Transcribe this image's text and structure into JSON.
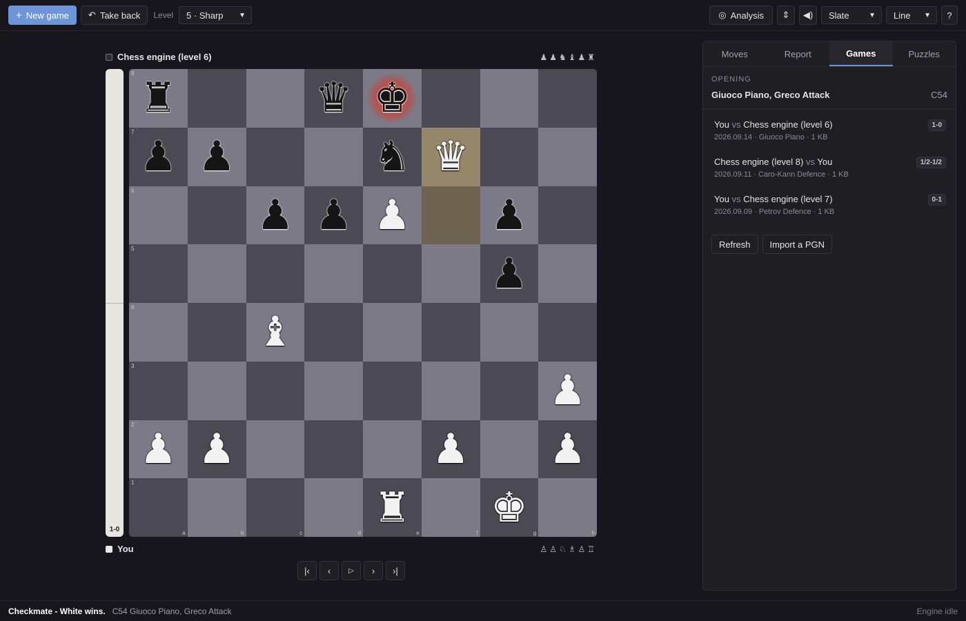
{
  "toolbar": {
    "new_game": "New game",
    "take_back": "Take back",
    "level_label": "Level",
    "level_value": "5 · Sharp",
    "analysis": "Analysis",
    "theme_value": "Slate",
    "style_value": "Line"
  },
  "top_player": {
    "name": "Chess engine (level 6)",
    "captured": "♟♟♞♝♟♜"
  },
  "bottom_player": {
    "name": "You",
    "captured": "♙♙♘♗♙♖"
  },
  "eval": {
    "score": "1-0",
    "white_fraction": 1.0
  },
  "board": {
    "ranks": [
      "8",
      "7",
      "6",
      "5",
      "4",
      "3",
      "2",
      "1"
    ],
    "files": [
      "a",
      "b",
      "c",
      "d",
      "e",
      "f",
      "g",
      "h"
    ],
    "rows": [
      [
        "r",
        "",
        "",
        "q",
        "k",
        "",
        "",
        ""
      ],
      [
        "p",
        "p",
        "",
        "",
        "n",
        "Q",
        "",
        ""
      ],
      [
        "",
        "",
        "p",
        "p",
        "P",
        "",
        "p",
        ""
      ],
      [
        "",
        "",
        "",
        "",
        "",
        "",
        "p",
        ""
      ],
      [
        "",
        "",
        "B",
        "",
        "",
        "",
        "",
        ""
      ],
      [
        "",
        "",
        "",
        "",
        "",
        "",
        "",
        "P"
      ],
      [
        "P",
        "P",
        "",
        "",
        "",
        "P",
        "",
        "P"
      ],
      [
        "",
        "",
        "",
        "",
        "R",
        "",
        "K",
        ""
      ]
    ],
    "last_move": [
      "f7",
      "f6"
    ],
    "check_square": "e8"
  },
  "panel": {
    "tabs": [
      "Moves",
      "Report",
      "Games",
      "Puzzles"
    ],
    "active_tab": "Games",
    "opening_label": "OPENING",
    "opening_name": "Giuoco Piano, Greco Attack",
    "opening_eco": "C54",
    "games": [
      {
        "white": "You",
        "vs": "vs",
        "black": "Chess engine (level 6)",
        "meta": "2026.09.14 · Giuoco Piano · 1 KB",
        "result": "1-0"
      },
      {
        "white": "Chess engine (level 8)",
        "vs": "vs",
        "black": "You",
        "meta": "2026.09.11 · Caro-Kann Defence · 1 KB",
        "result": "1/2-1/2"
      },
      {
        "white": "You",
        "vs": "vs",
        "black": "Chess engine (level 7)",
        "meta": "2026.09.09 · Petrov Defence · 1 KB",
        "result": "0-1"
      }
    ],
    "refresh": "Refresh",
    "import_pgn": "Import a PGN"
  },
  "status": {
    "main": "Checkmate - White wins.",
    "sub": "C54 Giuoco Piano, Greco Attack",
    "engine": "Engine idle"
  },
  "colors": {
    "accent": "#6d96d9",
    "light_square": "#7b7a86",
    "dark_square": "#4b4a54",
    "check": "#e6463c"
  }
}
